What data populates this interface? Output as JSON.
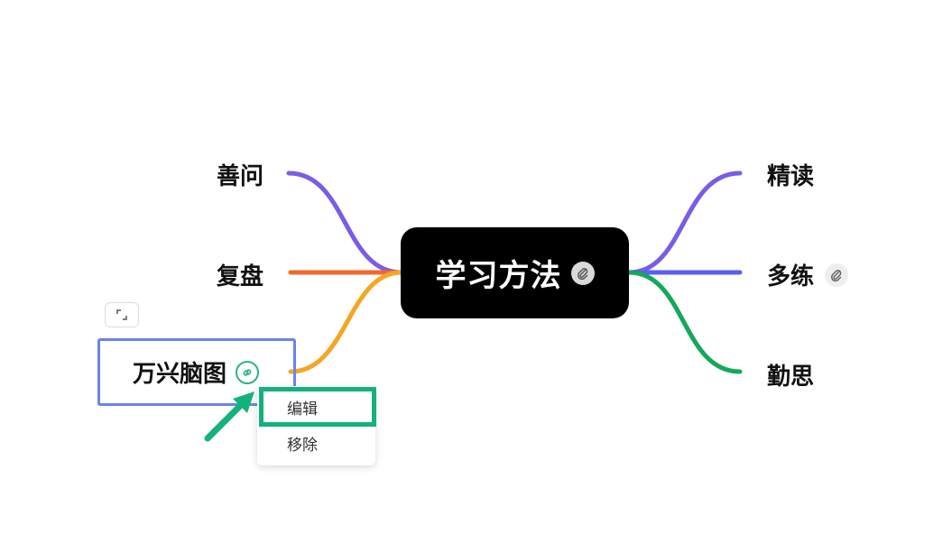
{
  "central_topic": {
    "title": "学习方法",
    "icon": "paperclip-icon"
  },
  "left_topics": [
    {
      "label": "善问",
      "color": "#7b5ce6"
    },
    {
      "label": "复盘",
      "color": "#f2682f"
    },
    {
      "label": "万兴脑图",
      "color": "#f5a623",
      "icon": "link-icon",
      "selected": true
    }
  ],
  "right_topics": [
    {
      "label": "精读",
      "color": "#7b5ce6"
    },
    {
      "label": "多练",
      "color": "#5a5ff0",
      "icon": "paperclip-icon"
    },
    {
      "label": "勤思",
      "color": "#14a85a"
    }
  ],
  "context_menu": {
    "items": [
      "编辑",
      "移除"
    ],
    "highlighted": "编辑"
  },
  "colors": {
    "selection": "#6a84ef",
    "highlight": "#14b27a",
    "central_bg": "#000000"
  }
}
